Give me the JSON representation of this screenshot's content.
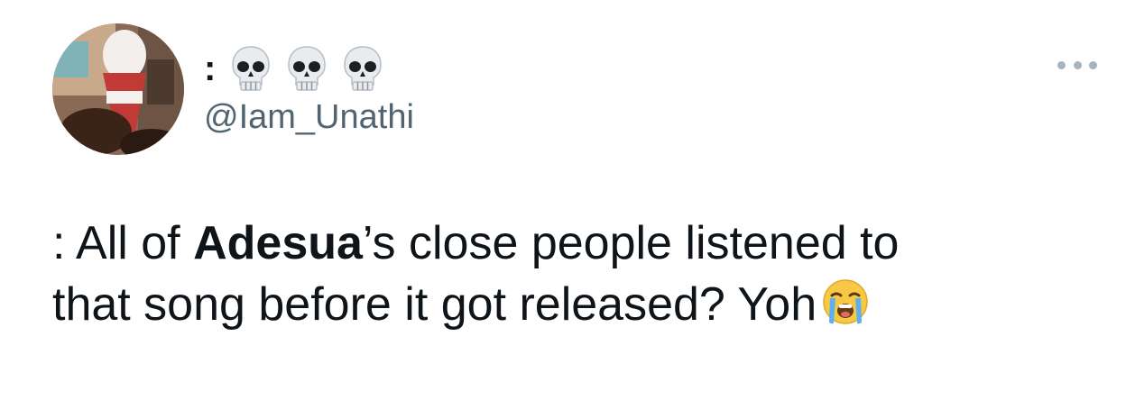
{
  "author": {
    "display_name_prefix": ":",
    "name_emoji": [
      "skull-emoji",
      "skull-emoji",
      "skull-emoji"
    ],
    "handle": "@Iam_Unathi",
    "avatar_icon": "avatar-photo"
  },
  "tweet": {
    "line1_prefix": ": All of ",
    "bold_word": "Adesua",
    "line1_suffix": "’s close people listened to",
    "line2": "that song before it got released? Yoh",
    "trailing_emoji": "loudly-crying-face-emoji"
  },
  "menu": {
    "icon": "more-horizontal-icon"
  },
  "colors": {
    "text_primary": "#0f1419",
    "text_secondary": "#536471",
    "more_dots": "#a8b3bc"
  }
}
